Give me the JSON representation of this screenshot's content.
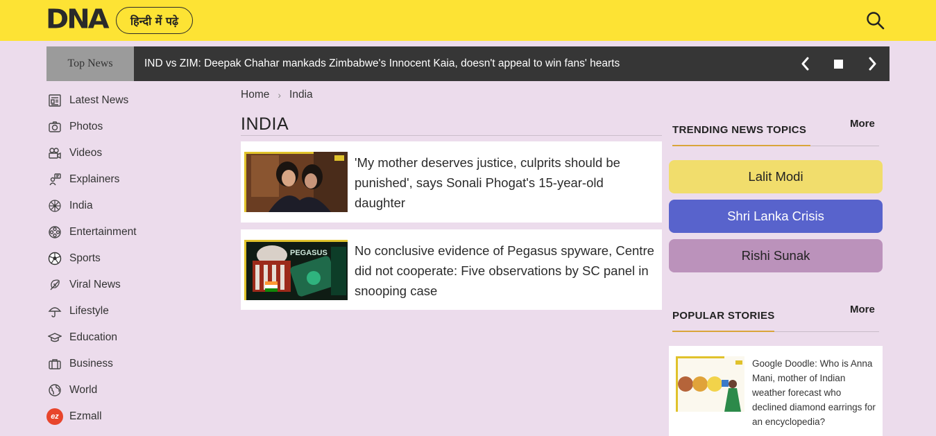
{
  "header": {
    "logo": "DNA",
    "hindi_button": "हिन्दी में पढ़े",
    "search_icon": "search-icon",
    "bg_color": "#fde334"
  },
  "ticker": {
    "label": "Top News",
    "headline": "IND vs ZIM: Deepak Chahar mankads Zimbabwe's Innocent Kaia, doesn't appeal to win fans' hearts",
    "controls": [
      "chevron-left-icon",
      "stop-icon",
      "chevron-right-icon"
    ]
  },
  "sidebar": {
    "items": [
      {
        "label": "Latest News",
        "icon": "newspaper-icon"
      },
      {
        "label": "Photos",
        "icon": "camera-icon"
      },
      {
        "label": "Videos",
        "icon": "video-icon"
      },
      {
        "label": "Explainers",
        "icon": "explainer-icon"
      },
      {
        "label": "India",
        "icon": "ashoka-chakra-icon"
      },
      {
        "label": "Entertainment",
        "icon": "film-reel-icon"
      },
      {
        "label": "Sports",
        "icon": "football-icon"
      },
      {
        "label": "Viral News",
        "icon": "feather-icon"
      },
      {
        "label": "Lifestyle",
        "icon": "umbrella-icon"
      },
      {
        "label": "Education",
        "icon": "graduation-cap-icon"
      },
      {
        "label": "Business",
        "icon": "briefcase-icon"
      },
      {
        "label": "World",
        "icon": "globe-icon"
      },
      {
        "label": "Ezmall",
        "icon": "ezmall-logo-icon",
        "badge": "ez"
      }
    ]
  },
  "main": {
    "breadcrumb": {
      "home": "Home",
      "current": "India"
    },
    "title": "INDIA",
    "articles": [
      {
        "headline": "'My mother deserves justice, culprits should be punished', says Sonali Phogat's 15-year-old daughter"
      },
      {
        "headline": "No conclusive evidence of Pegasus spyware, Centre did not cooperate: Five observations by SC panel in snooping case",
        "thumb_caption": "PEGASUS"
      }
    ]
  },
  "rail": {
    "trending": {
      "heading": "TRENDING NEWS TOPICS",
      "more": "More",
      "topics": [
        {
          "label": "Lalit Modi",
          "bg": "#f1dd6c",
          "fg": "#222"
        },
        {
          "label": "Shri Lanka Crisis",
          "bg": "#5863cc",
          "fg": "#ffffff"
        },
        {
          "label": "Rishi Sunak",
          "bg": "#bb92bb",
          "fg": "#222"
        }
      ]
    },
    "popular": {
      "heading": "POPULAR STORIES",
      "more": "More",
      "stories": [
        {
          "headline": "Google Doodle: Who is Anna Mani, mother of Indian weather forecast who declined diamond earrings for an encyclopedia?"
        }
      ]
    }
  }
}
